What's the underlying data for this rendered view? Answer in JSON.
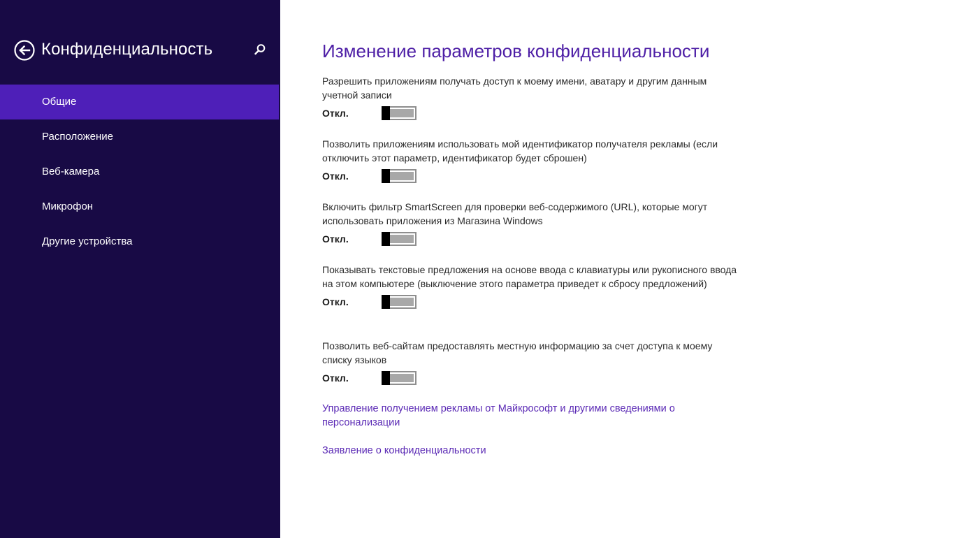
{
  "nav": {
    "title": "Конфиденциальность",
    "back_icon": "back-arrow-circle-icon",
    "search_icon": "search-icon",
    "items": [
      {
        "label": "Общие",
        "selected": true
      },
      {
        "label": "Расположение",
        "selected": false
      },
      {
        "label": "Веб-камера",
        "selected": false
      },
      {
        "label": "Микрофон",
        "selected": false
      },
      {
        "label": "Другие устройства",
        "selected": false
      }
    ]
  },
  "main": {
    "title": "Изменение параметров конфиденциальности",
    "settings": [
      {
        "description": "Разрешить приложениям получать доступ к моему имени, аватару и другим данным учетной записи",
        "state_label": "Откл.",
        "on": false
      },
      {
        "description": "Позволить приложениям использовать мой идентификатор получателя рекламы (если отключить этот параметр, идентификатор будет сброшен)",
        "state_label": "Откл.",
        "on": false
      },
      {
        "description": "Включить фильтр SmartScreen для проверки веб-содержимого (URL), которые могут использовать приложения из Магазина Windows",
        "state_label": "Откл.",
        "on": false
      },
      {
        "description": "Показывать текстовые предложения на основе ввода с клавиатуры или рукописного ввода на этом компьютере (выключение этого параметра приведет к сбросу предложений)",
        "state_label": "Откл.",
        "on": false
      },
      {
        "description": "Позволить веб-сайтам предоставлять местную информацию за счет доступа к моему списку языков",
        "state_label": "Откл.",
        "on": false
      }
    ],
    "links": [
      {
        "label": "Управление получением рекламы от Майкрософт и другими сведениями о персонализации"
      },
      {
        "label": "Заявление о конфиденциальности"
      }
    ]
  },
  "colors": {
    "nav_background": "#180a45",
    "nav_selected": "#4e1fb8",
    "accent_title": "#4e1fa6",
    "link": "#5b2ab5"
  }
}
